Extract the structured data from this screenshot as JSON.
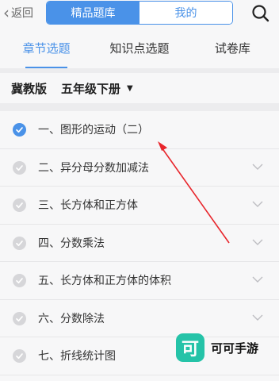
{
  "header": {
    "back_label": "返回",
    "segment_tabs": [
      {
        "label": "精品题库",
        "active": true
      },
      {
        "label": "我的",
        "active": false
      }
    ],
    "search_icon": "search-icon"
  },
  "tabs": [
    {
      "label": "章节选题",
      "active": true
    },
    {
      "label": "知识点选题",
      "active": false
    },
    {
      "label": "试卷库",
      "active": false
    }
  ],
  "filter": {
    "edition": "冀教版",
    "grade": "五年级下册"
  },
  "chapters": [
    {
      "label": "一、图形的运动（二）",
      "checked": true
    },
    {
      "label": "二、异分母分数加减法",
      "checked": false
    },
    {
      "label": "三、长方体和正方体",
      "checked": false
    },
    {
      "label": "四、分数乘法",
      "checked": false
    },
    {
      "label": "五、长方体和正方体的体积",
      "checked": false
    },
    {
      "label": "六、分数除法",
      "checked": false
    },
    {
      "label": "七、折线统计图",
      "checked": false
    }
  ],
  "watermark": {
    "logo_char": "可",
    "text": "可可手游"
  },
  "colors": {
    "accent": "#4a92e8",
    "unchecked": "#d6d6d9",
    "annotation_arrow": "#e8262c",
    "watermark_green": "#25c3a8"
  }
}
